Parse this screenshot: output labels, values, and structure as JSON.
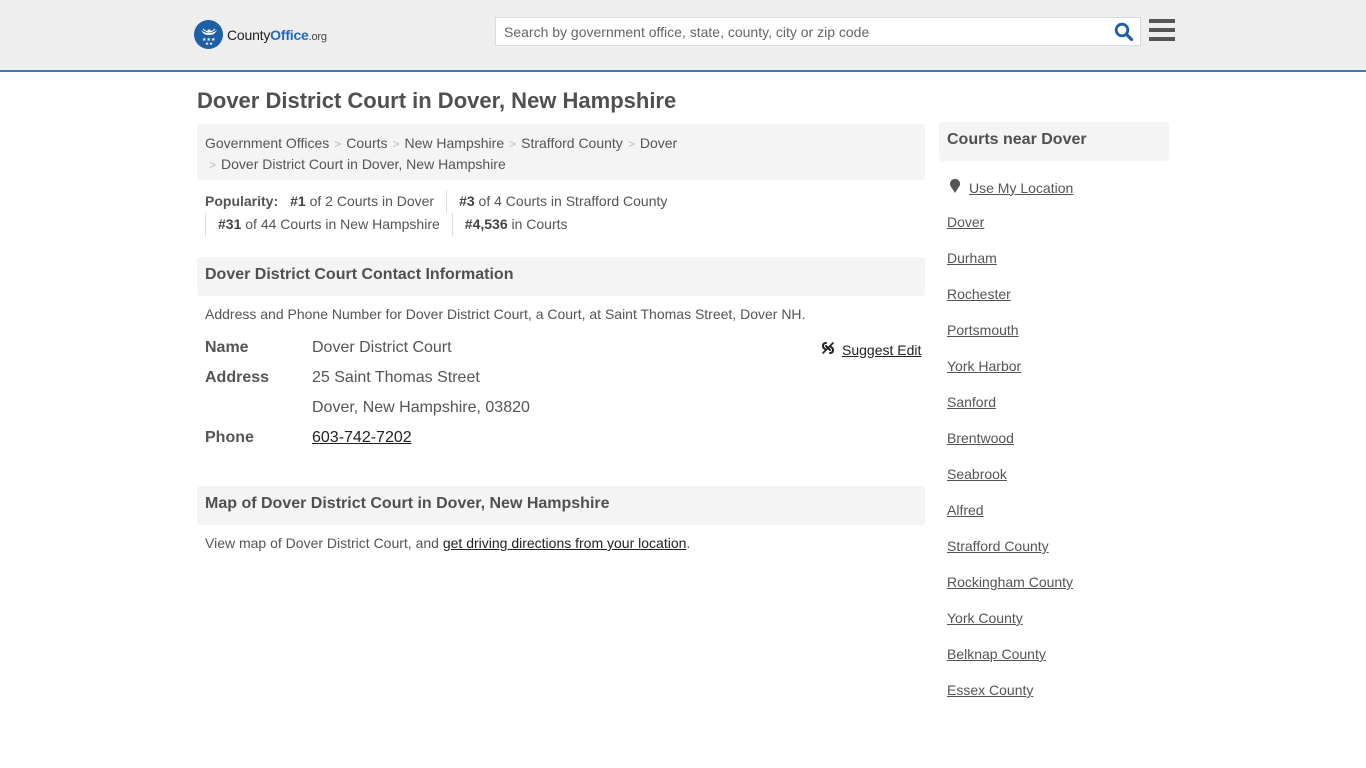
{
  "header": {
    "logo": {
      "county": "County",
      "office": "Office",
      "org": ".org",
      "icon": "eagle-stars-badge-icon"
    },
    "search": {
      "placeholder": "Search by government office, state, county, city or zip code",
      "value": "",
      "icon": "search-icon"
    },
    "menu_icon": "hamburger-menu-icon",
    "accent_color": "#3a7bb5"
  },
  "page": {
    "title": "Dover District Court in Dover, New Hampshire"
  },
  "breadcrumb": {
    "items": [
      "Government Offices",
      "Courts",
      "New Hampshire",
      "Strafford County",
      "Dover"
    ],
    "current": "Dover District Court in Dover, New Hampshire",
    "separator": ">"
  },
  "popularity": {
    "label": "Popularity:",
    "items": [
      {
        "rank": "#1",
        "text": " of 2 Courts in Dover"
      },
      {
        "rank": "#3",
        "text": " of 4 Courts in Strafford County"
      },
      {
        "rank": "#31",
        "text": " of 44 Courts in New Hampshire"
      },
      {
        "rank": "#4,536",
        "text": " in Courts"
      }
    ]
  },
  "contact": {
    "heading": "Dover District Court Contact Information",
    "description": "Address and Phone Number for Dover District Court, a Court, at Saint Thomas Street, Dover NH.",
    "suggest_edit": "Suggest Edit",
    "suggest_icon": "broken-link-icon",
    "name_label": "Name",
    "name_value": "Dover District Court",
    "address_label": "Address",
    "address_line1": "25 Saint Thomas Street",
    "address_line2": "Dover, New Hampshire, 03820",
    "phone_label": "Phone",
    "phone_value": "603-742-7202"
  },
  "map": {
    "heading": "Map of Dover District Court in Dover, New Hampshire",
    "text_before": "View map of Dover District Court, and ",
    "link": "get driving directions from your location",
    "text_after": "."
  },
  "sidebar": {
    "heading": "Courts near Dover",
    "use_location": "Use My Location",
    "location_icon": "map-pin-icon",
    "items": [
      "Dover",
      "Durham",
      "Rochester",
      "Portsmouth",
      "York Harbor",
      "Sanford",
      "Brentwood",
      "Seabrook",
      "Alfred",
      "Strafford County",
      "Rockingham County",
      "York County",
      "Belknap County",
      "Essex County"
    ]
  }
}
